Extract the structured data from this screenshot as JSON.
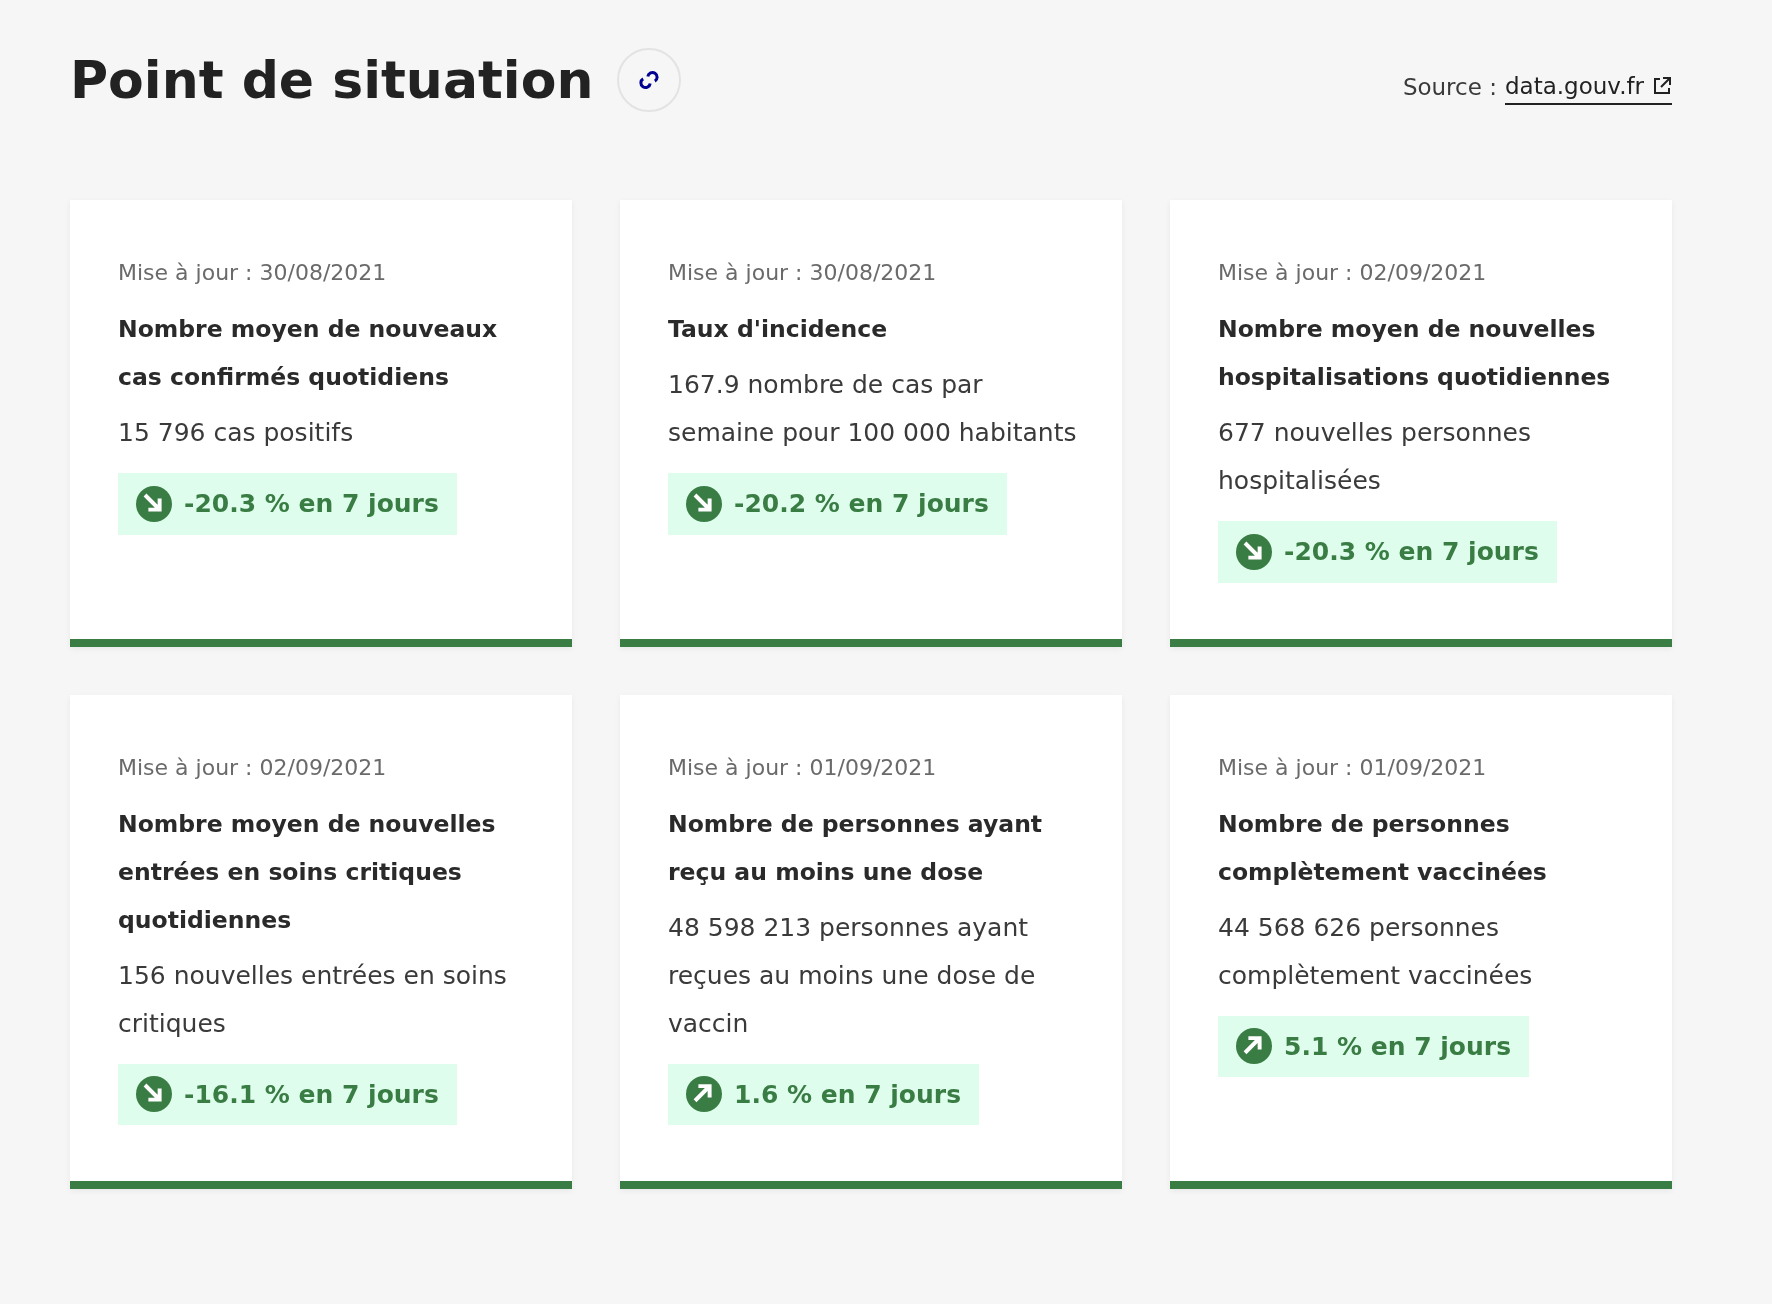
{
  "title": "Point de situation",
  "source": {
    "label": "Source :",
    "link": "data.gouv.fr"
  },
  "cards": [
    {
      "updated": "Mise à jour : 30/08/2021",
      "title": "Nombre moyen de nouveaux cas confirmés quotidiens",
      "value": "15 796 cas positifs",
      "trend": {
        "kind": "down",
        "text": "-20.3 % en 7 jours"
      }
    },
    {
      "updated": "Mise à jour : 30/08/2021",
      "title": "Taux d'incidence",
      "value": "167.9 nombre de cas par semaine pour 100 000 habitants",
      "trend": {
        "kind": "down",
        "text": "-20.2 % en 7 jours"
      }
    },
    {
      "updated": "Mise à jour : 02/09/2021",
      "title": "Nombre moyen de nouvelles hospitalisations quotidiennes",
      "value": "677 nouvelles personnes hospitalisées",
      "trend": {
        "kind": "down",
        "text": "-20.3 % en 7 jours"
      }
    },
    {
      "updated": "Mise à jour : 02/09/2021",
      "title": "Nombre moyen de nouvelles entrées en soins critiques quotidiennes",
      "value": "156 nouvelles entrées en soins critiques",
      "trend": {
        "kind": "down",
        "text": "-16.1 % en 7 jours"
      }
    },
    {
      "updated": "Mise à jour : 01/09/2021",
      "title": "Nombre de personnes ayant reçu au moins une dose",
      "value": "48 598 213 personnes ayant reçues au moins une dose de vaccin",
      "trend": {
        "kind": "up",
        "text": "1.6 % en 7 jours"
      }
    },
    {
      "updated": "Mise à jour : 01/09/2021",
      "title": "Nombre de personnes complètement vaccinées",
      "value": "44 568 626 personnes complètement vaccinées",
      "trend": {
        "kind": "up",
        "text": "5.1 % en 7 jours"
      }
    }
  ]
}
